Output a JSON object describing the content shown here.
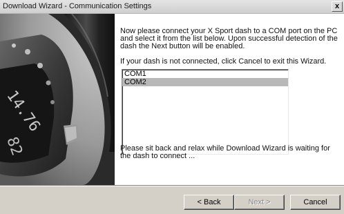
{
  "window": {
    "title": "Download Wizard - Communication Settings",
    "close_label": "x"
  },
  "hero_image": {
    "icon": "steering-wheel-dash-photo",
    "display_digits": [
      "14.76",
      "82"
    ]
  },
  "instructions": {
    "intro": "Now please connect your X Sport dash to a COM port on the PC and select it from the list below. Upon successful detection of the dash the Next button will be enabled.",
    "cancel_hint": "If your dash is not connected, click Cancel to exit this Wizard."
  },
  "port_list": {
    "items": [
      {
        "label": "COM1",
        "selected": false
      },
      {
        "label": "COM2",
        "selected": true
      }
    ]
  },
  "status": {
    "message": "Please sit back and relax while Download Wizard is waiting for the dash to connect ..."
  },
  "buttons": {
    "back": "< Back",
    "next": "Next >",
    "cancel": "Cancel",
    "next_enabled": false
  },
  "colors": {
    "list_selection": "#b8b8b8",
    "dialog_face": "#d4d0c8"
  }
}
